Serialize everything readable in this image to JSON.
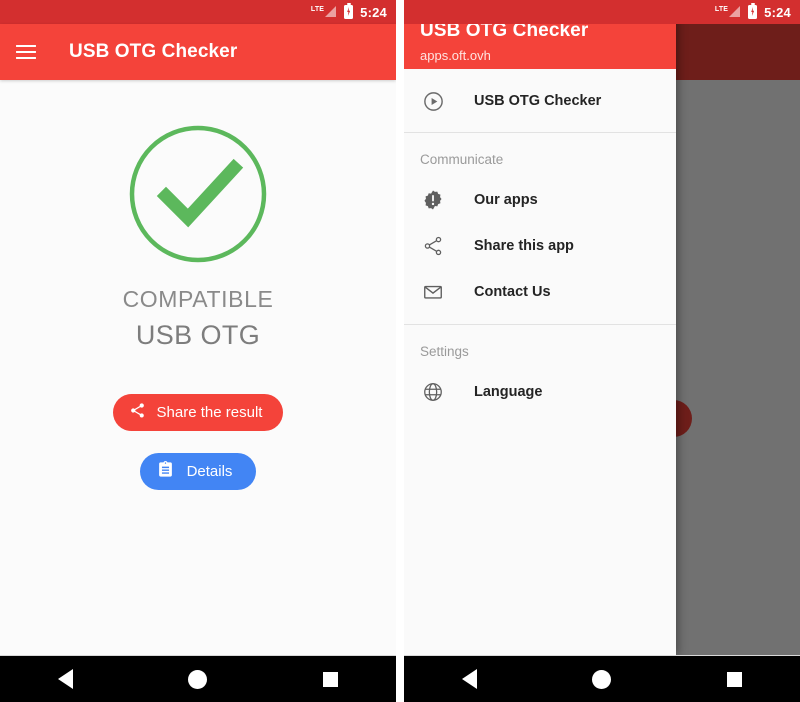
{
  "status_bar": {
    "network_label": "LTE",
    "time": "5:24",
    "signal_icon": "signal-bars-icon",
    "battery_icon": "battery-charging-icon"
  },
  "colors": {
    "primary_red": "#f4433a",
    "status_red": "#d32f2f",
    "accent_blue": "#4285f4",
    "success_green": "#5cb85c",
    "text_gray": "#8a8a8a"
  },
  "left_screen": {
    "app_bar": {
      "menu_icon": "hamburger-menu-icon",
      "title": "USB OTG Checker"
    },
    "result": {
      "icon": "check-circle-icon",
      "status": "COMPATIBLE",
      "subject": "USB OTG"
    },
    "buttons": {
      "share": {
        "label": "Share the result",
        "icon": "share-icon"
      },
      "details": {
        "label": "Details",
        "icon": "clipboard-icon"
      }
    }
  },
  "right_screen": {
    "drawer": {
      "header": {
        "title": "USB OTG Checker",
        "subtitle": "apps.oft.ovh"
      },
      "primary_item": {
        "label": "USB OTG Checker",
        "icon": "play-circle-icon"
      },
      "groups": [
        {
          "title": "Communicate",
          "items": [
            {
              "label": "Our apps",
              "icon": "badge-alert-icon"
            },
            {
              "label": "Share this app",
              "icon": "share-icon"
            },
            {
              "label": "Contact Us",
              "icon": "envelope-icon"
            }
          ]
        },
        {
          "title": "Settings",
          "items": [
            {
              "label": "Language",
              "icon": "globe-icon"
            }
          ]
        }
      ]
    }
  },
  "nav_bar": {
    "back": "back-triangle-icon",
    "home": "home-circle-icon",
    "recents": "recents-square-icon"
  }
}
